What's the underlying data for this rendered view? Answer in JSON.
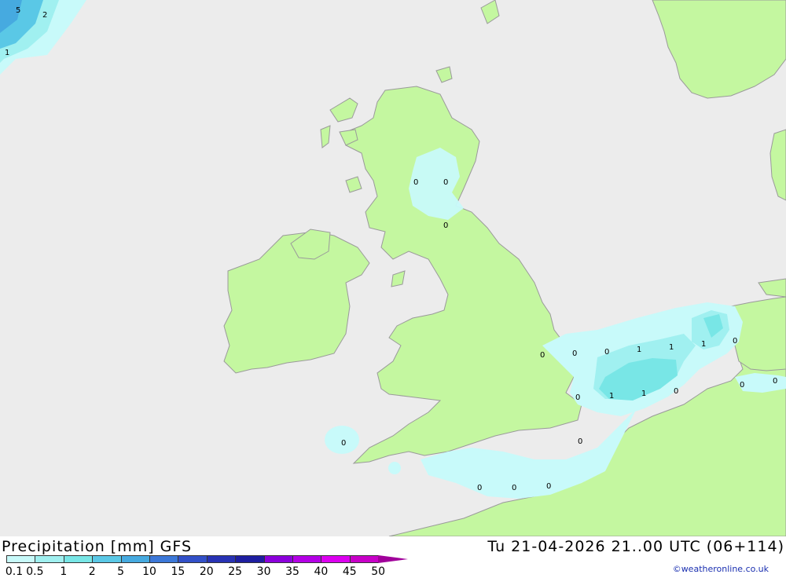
{
  "map": {
    "contour_labels": [
      "5",
      "2",
      "1",
      "0",
      "0",
      "0",
      "0",
      "0",
      "0",
      "1",
      "1",
      "1",
      "0",
      "0",
      "1",
      "1",
      "0",
      "0",
      "0",
      "0",
      "0",
      "0",
      "0",
      "0"
    ]
  },
  "footer": {
    "title": "Precipitation [mm] GFS",
    "valid_time": "Tu 21-04-2026 21..00 UTC (06+114)",
    "credit": "©weatheronline.co.uk"
  },
  "scale": {
    "labels": [
      "0.1",
      "0.5",
      "1",
      "2",
      "5",
      "10",
      "15",
      "20",
      "25",
      "30",
      "35",
      "40",
      "45",
      "50"
    ],
    "colors": [
      "#c8fafa",
      "#a0f0f0",
      "#78e6e6",
      "#5ac8e6",
      "#46aae0",
      "#3c78d8",
      "#3250c8",
      "#2832b4",
      "#1e1ea0",
      "#8c00dc",
      "#b400e6",
      "#dc00f0",
      "#c800c8",
      "#a0009a"
    ]
  },
  "colors": {
    "sea": "#ececec",
    "land": "#c4f7a0",
    "coast": "#9a9a9a",
    "precip_light": "#c8fafa",
    "precip_medium": "#a0f0f0",
    "precip_heavy": "#78e6e6"
  }
}
